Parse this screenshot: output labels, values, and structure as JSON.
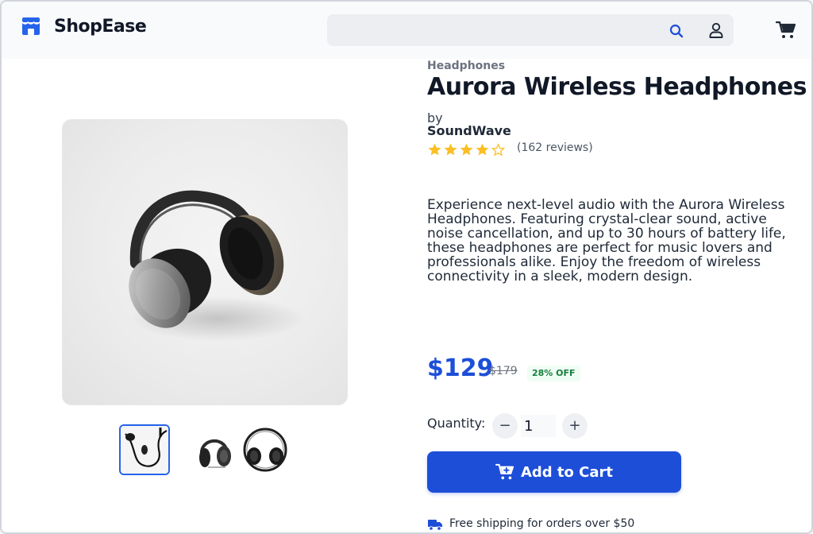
{
  "colors": {
    "accent": "#1d4ed8",
    "star": "#fbbf24",
    "discount_text": "#15803d",
    "discount_bg": "#f0fdf4"
  },
  "header": {
    "brand": "ShopEase",
    "search_placeholder": "",
    "icons": [
      "store-icon",
      "search-icon",
      "user-icon",
      "cart-icon"
    ]
  },
  "product": {
    "category": "Headphones",
    "title": "Aurora Wireless Headphones",
    "by_label": "by",
    "brand": "SoundWave",
    "rating": 4,
    "rating_max": 5,
    "reviews": "(162 reviews)",
    "description": "Experience next-level audio with the Aurora Wireless Headphones. Featuring crystal-clear sound, active noise cancellation, and up to 30 hours of battery life, these headphones are perfect for music lovers and professionals alike. Enjoy the freedom of wireless connectivity in a sleek, modern design.",
    "price": "$129",
    "old_price": "$179",
    "discount": "28% OFF",
    "images": {
      "main": "headphones-main-image",
      "thumbnails": [
        "thumb-earphones",
        "thumb-headphones-side",
        "thumb-headphones-top"
      ],
      "selected_thumbnail": 0
    }
  },
  "quantity": {
    "label": "Quantity:",
    "minus": "−",
    "plus": "+",
    "value": "1"
  },
  "cart": {
    "add_label": "Add to Cart"
  },
  "shipping": {
    "text": "Free shipping for orders over $50"
  }
}
